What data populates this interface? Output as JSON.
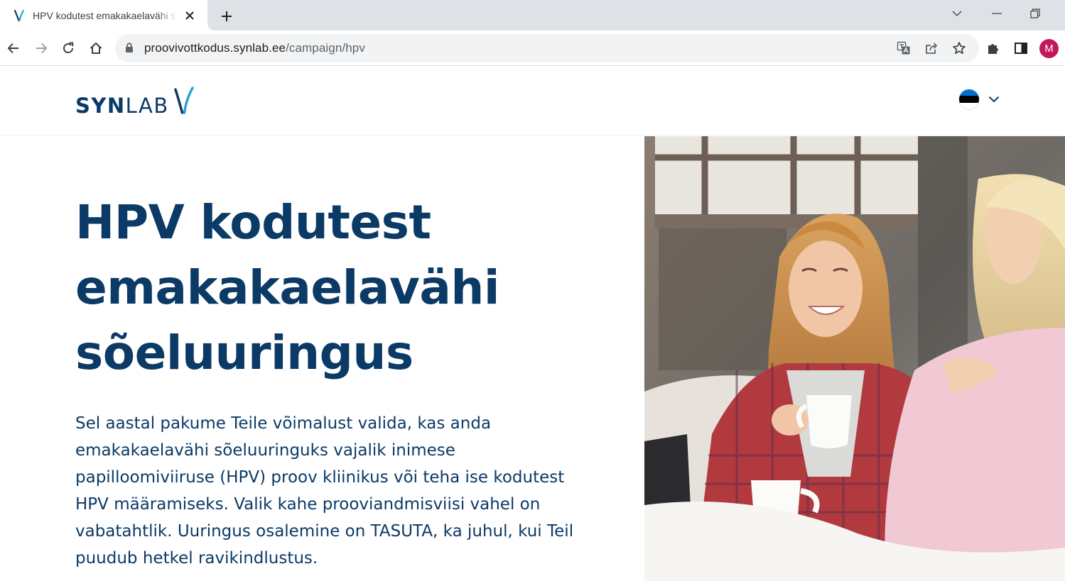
{
  "browser": {
    "tab": {
      "title": "HPV kodutest emakakaelavähi sõeluuringus"
    },
    "url": {
      "host": "proovivottkodus.synlab.ee",
      "path": "/campaign/hpv"
    },
    "profile_initial": "M"
  },
  "header": {
    "logo": {
      "bold": "SYN",
      "light": "LAB"
    },
    "language": "Eesti"
  },
  "hero": {
    "title_lines": [
      "HPV kodutest",
      "emakakaelavähi",
      "sõeluuringus"
    ],
    "text_lines": [
      "Sel aastal pakume Teile võimalust valida, kas anda",
      "emakakaelavähi sõeluuringuks vajalik inimese",
      "papilloomiviiruse (HPV) proov kliinikus või teha ise kodutest",
      "HPV määramiseks. Valik kahe prooviandmisviisi vahel on",
      "vabatahtlik. Uuringus osalemine on TASUTA, ka juhul, kui Teil",
      "puudub hetkel ravikindlustus."
    ]
  },
  "colors": {
    "brand": "#0b3a67",
    "accent": "#2aa3d6",
    "flag": [
      "#0072ce",
      "#000000",
      "#ffffff"
    ]
  },
  "icons": {
    "back": "arrow-left-icon",
    "forward": "arrow-right-icon",
    "reload": "reload-icon",
    "home": "home-icon",
    "lock": "lock-icon",
    "translate": "translate-icon",
    "share": "share-icon",
    "bookmark": "star-icon",
    "extensions": "puzzle-icon",
    "sidepanel": "side-panel-icon"
  }
}
